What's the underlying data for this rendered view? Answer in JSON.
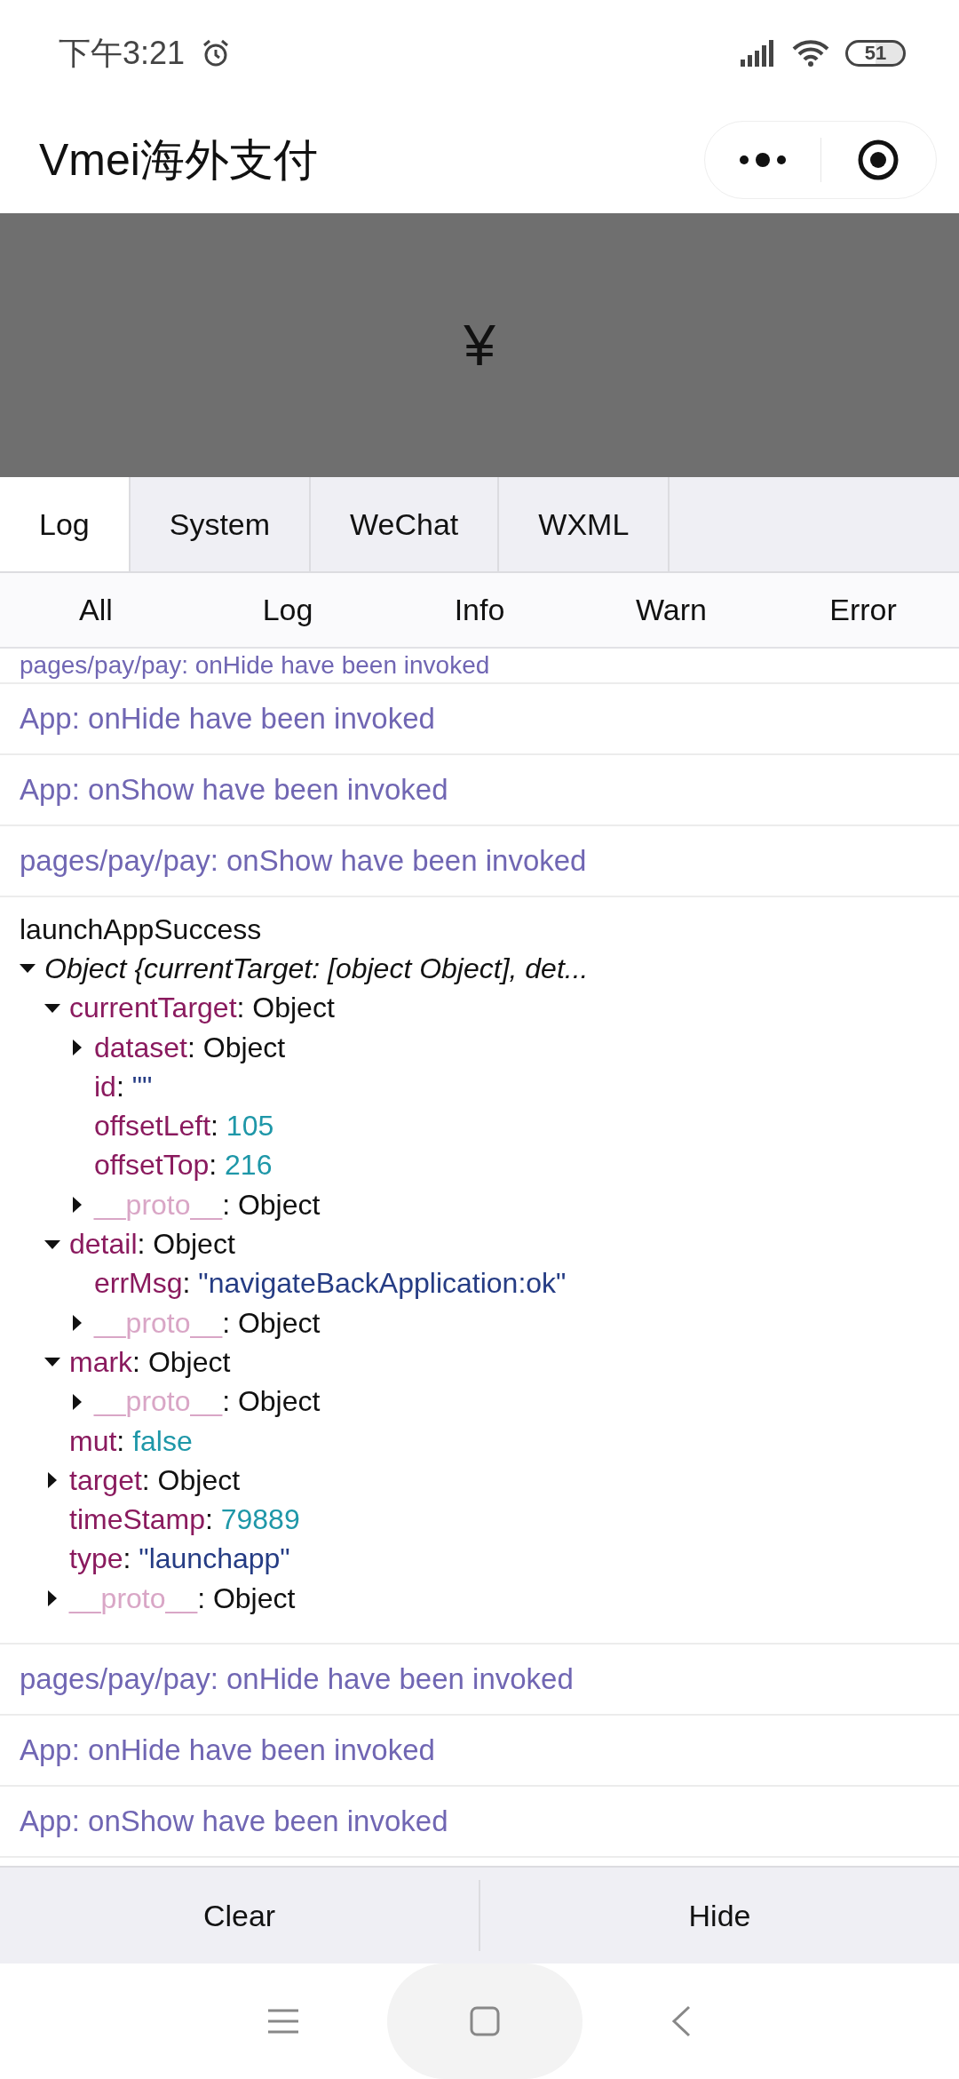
{
  "status_bar": {
    "time": "下午3:21",
    "battery": "51"
  },
  "title_bar": {
    "title": "Vmei海外支付"
  },
  "banner": {
    "symbol": "¥"
  },
  "tabs": [
    {
      "label": "Log",
      "selected": true
    },
    {
      "label": "System",
      "selected": false
    },
    {
      "label": "WeChat",
      "selected": false
    },
    {
      "label": "WXML",
      "selected": false
    }
  ],
  "filters": [
    "All",
    "Log",
    "Info",
    "Warn",
    "Error"
  ],
  "log_entries": [
    {
      "kind": "message",
      "text": "pages/pay/pay: onHide have been invoked",
      "partial": true
    },
    {
      "kind": "message",
      "text": "App: onHide have been invoked"
    },
    {
      "kind": "message",
      "text": "App: onShow have been invoked"
    },
    {
      "kind": "message",
      "text": "pages/pay/pay: onShow have been invoked"
    },
    {
      "kind": "object",
      "title": "launchAppSuccess",
      "tree": {
        "summary": "Object {currentTarget: [object Object], det...",
        "expanded": true,
        "children": [
          {
            "key": "currentTarget",
            "separator": ":",
            "value": "Object",
            "kind": "object",
            "expanded": true,
            "children": [
              {
                "key": "dataset",
                "separator": ":",
                "value": "Object",
                "kind": "object",
                "expanded": false
              },
              {
                "key": "id",
                "separator": ":",
                "value": "\"\"",
                "kind": "string"
              },
              {
                "key": "offsetLeft",
                "separator": ":",
                "value": "105",
                "kind": "number"
              },
              {
                "key": "offsetTop",
                "separator": ":",
                "value": "216",
                "kind": "number"
              },
              {
                "key": "__proto__",
                "separator": ":",
                "value": "Object",
                "kind": "proto",
                "expanded": false
              }
            ]
          },
          {
            "key": "detail",
            "separator": ":",
            "value": "Object",
            "kind": "object",
            "expanded": true,
            "children": [
              {
                "key": "errMsg",
                "separator": ":",
                "value": "\"navigateBackApplication:ok\"",
                "kind": "string"
              },
              {
                "key": "__proto__",
                "separator": ":",
                "value": "Object",
                "kind": "proto",
                "expanded": false
              }
            ]
          },
          {
            "key": "mark",
            "separator": ":",
            "value": "Object",
            "kind": "object",
            "expanded": true,
            "children": [
              {
                "key": "__proto__",
                "separator": ":",
                "value": "Object",
                "kind": "proto",
                "expanded": false
              }
            ]
          },
          {
            "key": "mut",
            "separator": ":",
            "value": "false",
            "kind": "number"
          },
          {
            "key": "target",
            "separator": ":",
            "value": "Object",
            "kind": "object",
            "expanded": false
          },
          {
            "key": "timeStamp",
            "separator": ":",
            "value": "79889",
            "kind": "number"
          },
          {
            "key": "type",
            "separator": ":",
            "value": "\"launchapp\"",
            "kind": "string"
          },
          {
            "key": "__proto__",
            "separator": ":",
            "value": "Object",
            "kind": "proto",
            "expanded": false
          }
        ]
      }
    },
    {
      "kind": "message",
      "text": "pages/pay/pay: onHide have been invoked"
    },
    {
      "kind": "message",
      "text": "App: onHide have been invoked"
    },
    {
      "kind": "message",
      "text": "App: onShow have been invoked"
    }
  ],
  "buttons": [
    "Clear",
    "Hide"
  ]
}
